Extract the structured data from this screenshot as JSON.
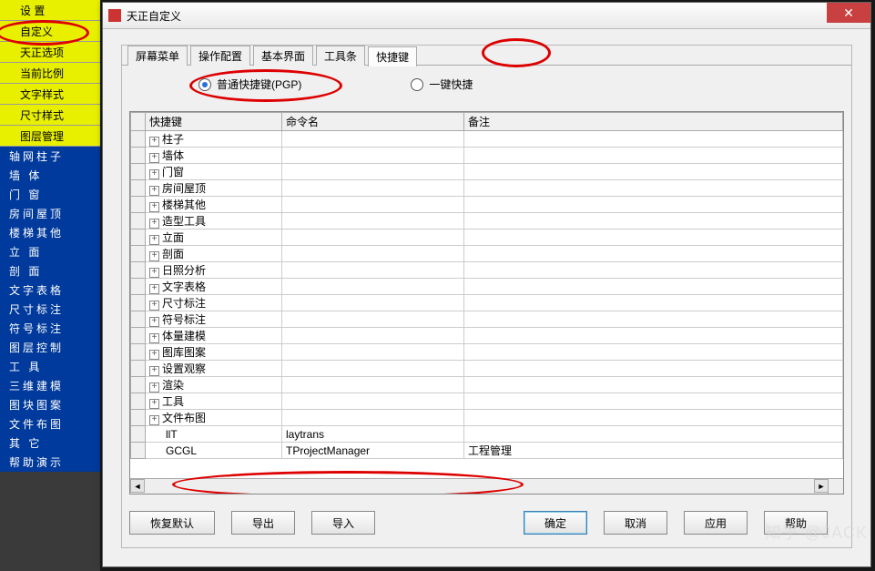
{
  "sidebar": {
    "yellow": [
      {
        "label": "设  置",
        "icon": "gear-icon"
      },
      {
        "label": "自定义",
        "icon": "custom-icon"
      },
      {
        "label": "天正选项",
        "icon": "options-icon"
      },
      {
        "label": "当前比例",
        "icon": "scale-icon"
      },
      {
        "label": "文字样式",
        "icon": "text-icon"
      },
      {
        "label": "尺寸样式",
        "icon": "dim-icon"
      },
      {
        "label": "图层管理",
        "icon": "layer-icon"
      }
    ],
    "blue": [
      "轴网柱子",
      "墙  体",
      "门  窗",
      "房间屋顶",
      "楼梯其他",
      "立  面",
      "剖  面",
      "文字表格",
      "尺寸标注",
      "符号标注",
      "图层控制",
      "工  具",
      "三维建模",
      "图块图案",
      "文件布图",
      "其  它",
      "帮助演示"
    ]
  },
  "dialog": {
    "title": "天正自定义",
    "tabs": [
      "屏幕菜单",
      "操作配置",
      "基本界面",
      "工具条",
      "快捷键"
    ],
    "active_tab": 4,
    "radios": {
      "a": "普通快捷键(PGP)",
      "b": "一键快捷",
      "selected": "a"
    },
    "columns": [
      "",
      "快捷键",
      "命令名",
      "备注"
    ],
    "rows": [
      {
        "t": 1,
        "k": "柱子"
      },
      {
        "t": 1,
        "k": "墙体"
      },
      {
        "t": 1,
        "k": "门窗"
      },
      {
        "t": 1,
        "k": "房间屋顶"
      },
      {
        "t": 1,
        "k": "楼梯其他"
      },
      {
        "t": 1,
        "k": "造型工具"
      },
      {
        "t": 1,
        "k": "立面"
      },
      {
        "t": 1,
        "k": "剖面"
      },
      {
        "t": 1,
        "k": "日照分析"
      },
      {
        "t": 1,
        "k": "文字表格"
      },
      {
        "t": 1,
        "k": "尺寸标注"
      },
      {
        "t": 1,
        "k": "符号标注"
      },
      {
        "t": 1,
        "k": "体量建模"
      },
      {
        "t": 1,
        "k": "图库图案"
      },
      {
        "t": 1,
        "k": "设置观察"
      },
      {
        "t": 1,
        "k": "渲染"
      },
      {
        "t": 1,
        "k": "工具"
      },
      {
        "t": 1,
        "k": "文件布图"
      },
      {
        "t": 0,
        "k": "llT",
        "c": "laytrans",
        "r": ""
      },
      {
        "t": 0,
        "k": "GCGL",
        "c": "TProjectManager",
        "r": "工程管理"
      }
    ],
    "buttons": {
      "reset": "恢复默认",
      "export": "导出",
      "import": "导入",
      "ok": "确定",
      "cancel": "取消",
      "apply": "应用",
      "help": "帮助"
    }
  },
  "watermark": "知乎 @JACK"
}
